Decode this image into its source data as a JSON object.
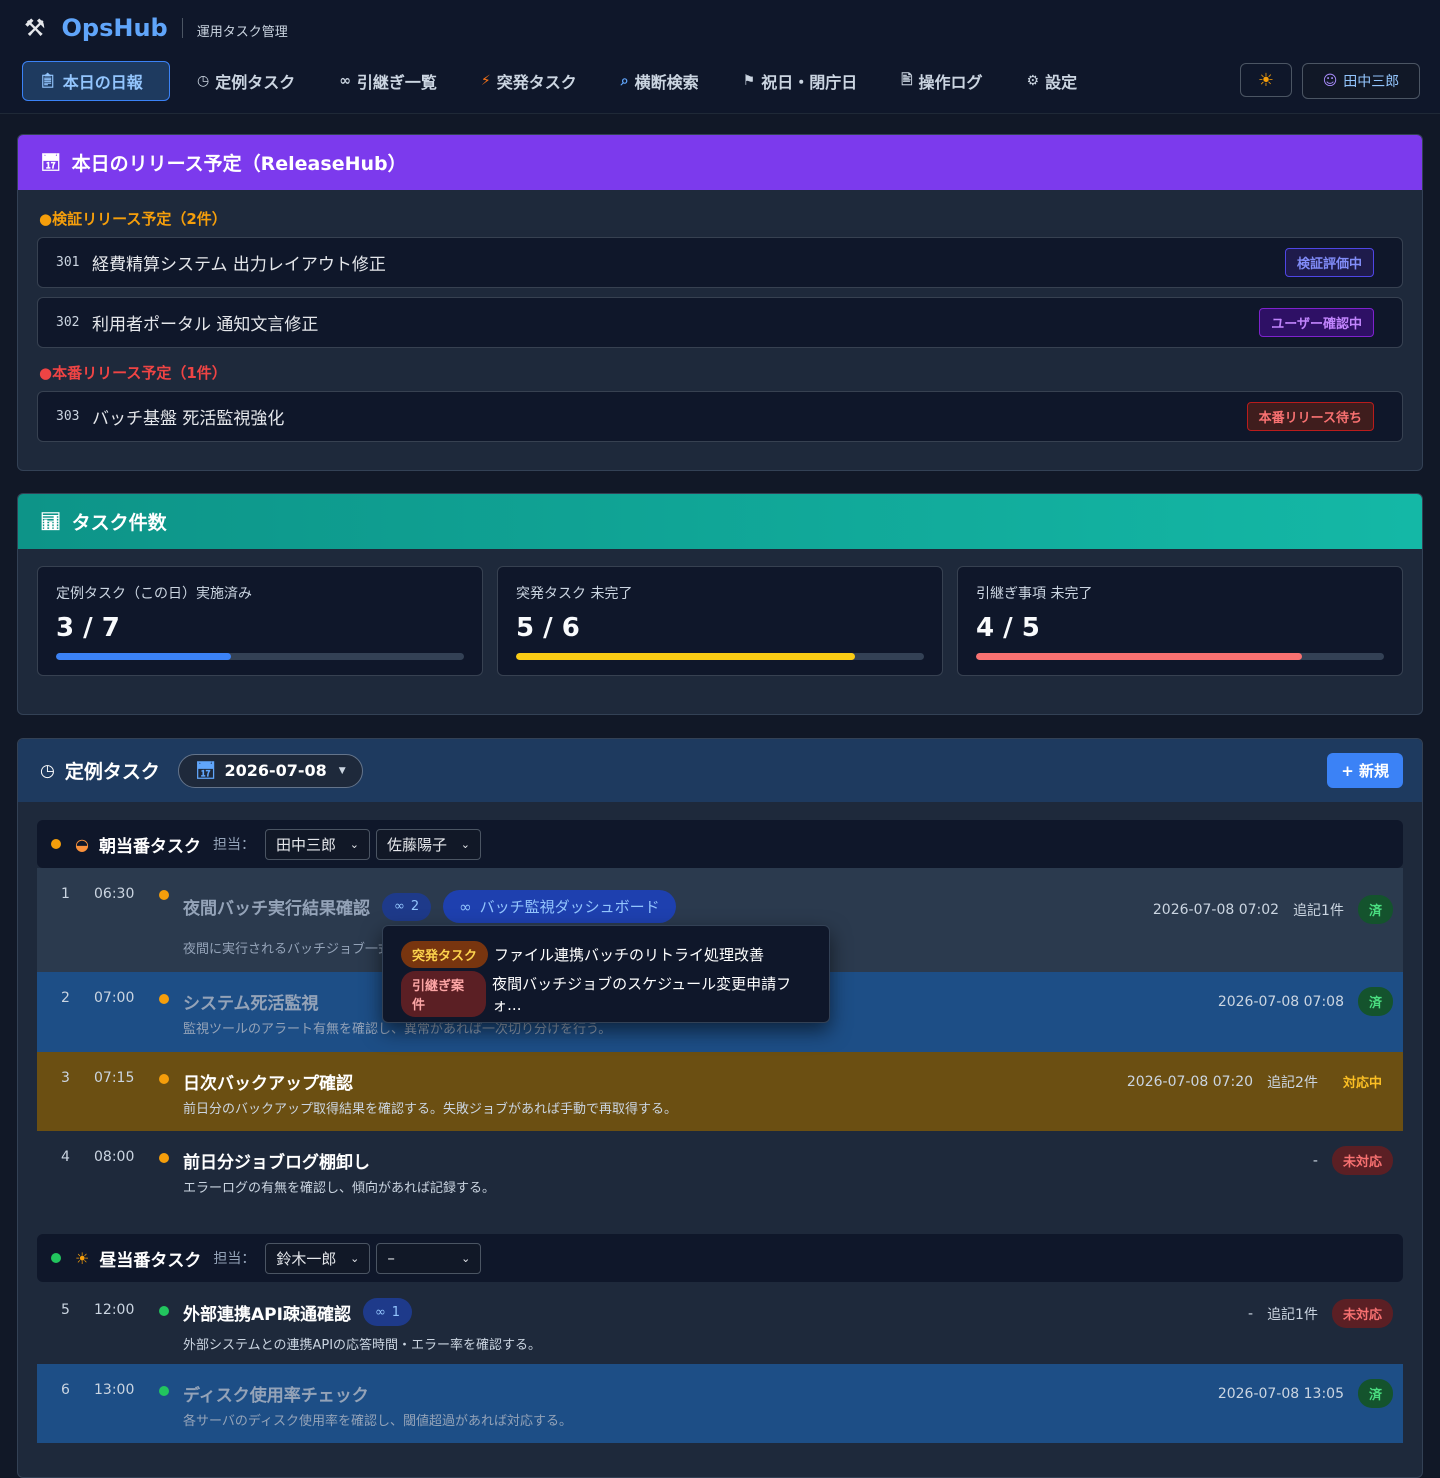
{
  "app": {
    "name": "OpsHub",
    "subtitle": "運用タスク管理",
    "logo_icon": "tools-icon"
  },
  "nav": {
    "items": [
      {
        "icon": "clipboard-icon",
        "label": "本日の日報",
        "active": true
      },
      {
        "icon": "clock-icon",
        "label": "定例タスク"
      },
      {
        "icon": "link-icon",
        "label": "引継ぎ一覧"
      },
      {
        "icon": "lightning-icon",
        "label": "突発タスク"
      },
      {
        "icon": "magnifier-icon",
        "label": "横断検索"
      },
      {
        "icon": "flags-icon",
        "label": "祝日・閉庁日"
      },
      {
        "icon": "memo-icon",
        "label": "操作ログ"
      },
      {
        "icon": "gear-icon",
        "label": "設定"
      }
    ],
    "theme_icon": "sun-icon",
    "user": "田中三郎"
  },
  "release": {
    "title": "本日のリリース予定（ReleaseHub）",
    "verify_group": "●検証リリース予定（2件）",
    "prod_group": "●本番リリース予定（1件）",
    "verify_items": [
      {
        "id": "301",
        "title": "経費精算システム 出力レイアウト修正",
        "status": "検証評価中"
      },
      {
        "id": "302",
        "title": "利用者ポータル 通知文言修正",
        "status": "ユーザー確認中"
      }
    ],
    "prod_items": [
      {
        "id": "303",
        "title": "バッチ基盤 死活監視強化",
        "status": "本番リリース待ち"
      }
    ]
  },
  "counts": {
    "title": "タスク件数",
    "boxes": [
      {
        "label": "定例タスク（この日）実施済み",
        "value": "3 / 7",
        "progress": 0.43,
        "color": "#3b82f6"
      },
      {
        "label": "突発タスク 未完了",
        "value": "5 / 6",
        "progress": 0.83,
        "color": "#facc15"
      },
      {
        "label": "引継ぎ事項 未完了",
        "value": "4 / 5",
        "progress": 0.8,
        "color": "#f87171"
      }
    ]
  },
  "routine": {
    "title": "定例タスク",
    "date": "2026-07-08",
    "new_button": "+ 新規",
    "assign_label": "担当：",
    "morning": {
      "title": "朝当番タスク",
      "dot_color": "#f59e0b",
      "assignee1": "田中三郎",
      "assignee2": "佐藤陽子",
      "tasks": [
        {
          "num": "1",
          "time": "06:30",
          "title": "夜間バッチ実行結果確認",
          "link_count": "2",
          "link_label": "バッチ監視ダッシュボード",
          "desc": "夜間に実行されるバッチジョブ一式",
          "timestamp": "2026-07-08 07:02",
          "note": "追記1件",
          "status": "済"
        },
        {
          "num": "2",
          "time": "07:00",
          "title": "システム死活監視",
          "desc": "監視ツールのアラート有無を確認し、異常があれば一次切り分けを行う。",
          "timestamp": "2026-07-08 07:08",
          "status": "済"
        },
        {
          "num": "3",
          "time": "07:15",
          "title": "日次バックアップ確認",
          "desc": "前日分のバックアップ取得結果を確認する。失敗ジョブがあれば手動で再取得する。",
          "timestamp": "2026-07-08 07:20",
          "note": "追記2件",
          "status": "対応中"
        },
        {
          "num": "4",
          "time": "08:00",
          "title": "前日分ジョブログ棚卸し",
          "desc": "エラーログの有無を確認し、傾向があれば記録する。",
          "timestamp": "-",
          "status": "未対応"
        }
      ]
    },
    "noon": {
      "title": "昼当番タスク",
      "dot_color": "#22c55e",
      "assignee1": "鈴木一郎",
      "assignee2": "–",
      "tasks": [
        {
          "num": "5",
          "time": "12:00",
          "title": "外部連携API疎通確認",
          "link_count": "1",
          "desc": "外部システムとの連携APIの応答時間・エラー率を確認する。",
          "timestamp": "-",
          "note": "追記1件",
          "status": "未対応"
        },
        {
          "num": "6",
          "time": "13:00",
          "title": "ディスク使用率チェック",
          "desc": "各サーバのディスク使用率を確認し、閾値超過があれば対応する。",
          "timestamp": "2026-07-08 13:05",
          "status": "済"
        }
      ]
    },
    "popover": [
      {
        "tag": "突発タスク",
        "text": "ファイル連携バッチのリトライ処理改善"
      },
      {
        "tag": "引継ぎ案件",
        "text": "夜間バッチジョブのスケジュール変更申請フォ..."
      }
    ]
  }
}
